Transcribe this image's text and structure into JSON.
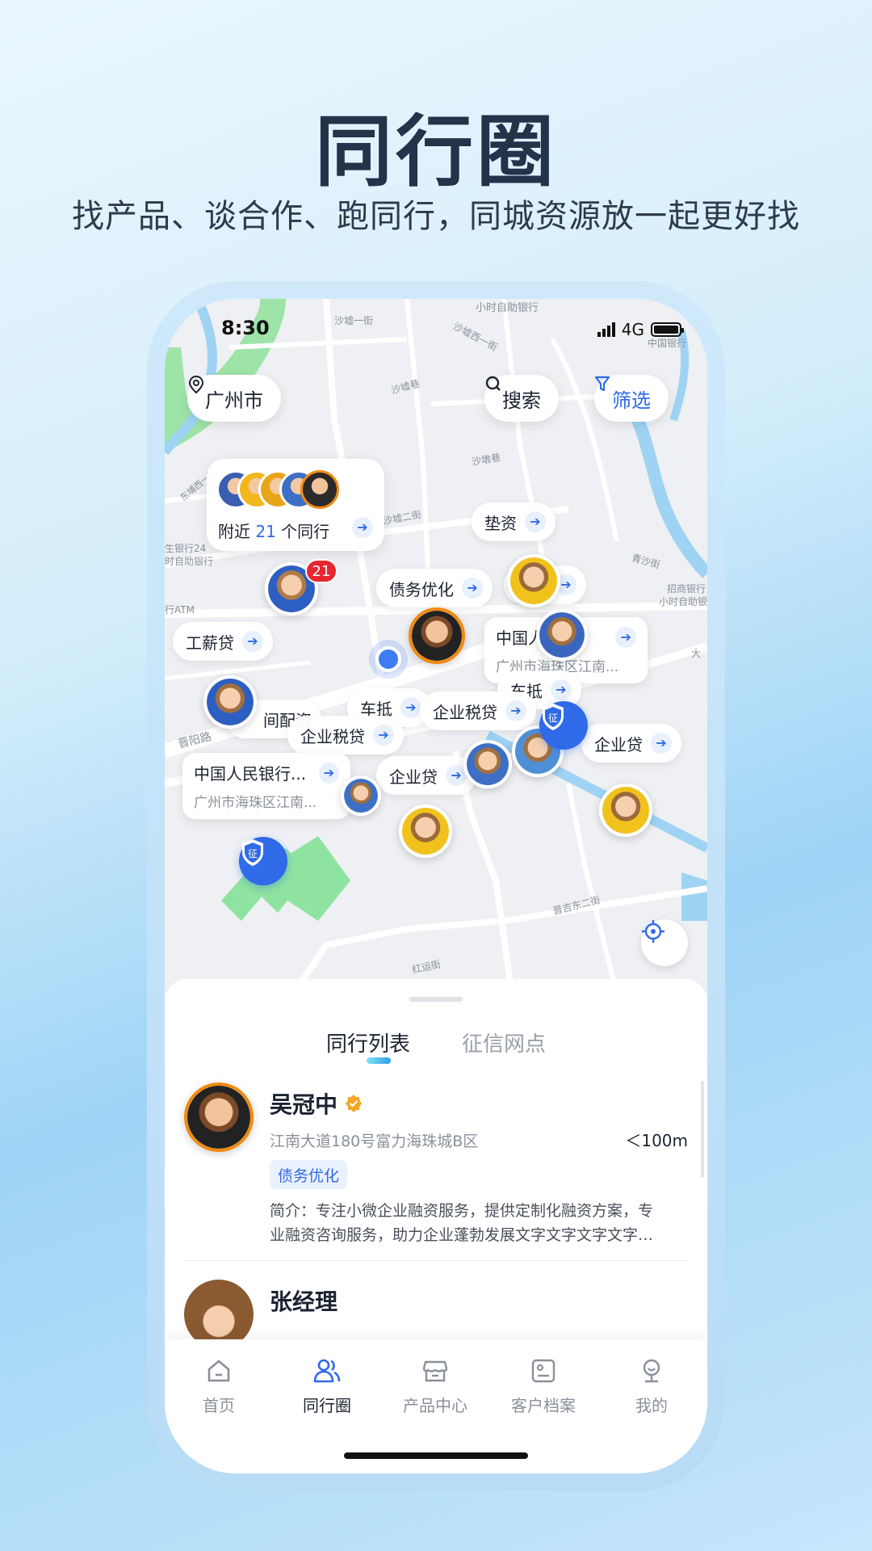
{
  "promo": {
    "title": "同行圈",
    "subtitle": "找产品、谈合作、跑同行，同城资源放一起更好找"
  },
  "status_bar": {
    "time": "8:30",
    "network": "4G"
  },
  "map": {
    "city_button": "广州市",
    "search_button": "搜索",
    "filter_button": "筛选",
    "nearby": {
      "prefix": "附近",
      "count": "21",
      "suffix": "个同行"
    },
    "cluster_badge": "21",
    "tags": {
      "dianzi": "垫资",
      "zhaiwu": "债务优化",
      "gongxin": "工薪贷",
      "chedi1": "车抵",
      "qiye_shuidai1": "企业税贷",
      "qiye_shuidai2": "企业税贷",
      "qiye_dai1": "企业贷",
      "qiye_dai2": "企业贷",
      "chedi2": "车抵",
      "peizi": "间配资",
      "partial": "贷"
    },
    "bank_card_1": {
      "title": "中国人民银行...",
      "address": "广州市海珠区江南..."
    },
    "bank_card_2": {
      "title": "中国人...",
      "address": "广州市海珠区江南..."
    },
    "shield_label": "征",
    "street_labels": {
      "s1": "沙墟一街",
      "s2": "沙墟西一街",
      "s3": "沙墟巷",
      "s4": "沙墟二街",
      "s5": "沙墩巷",
      "s6": "晋阳路",
      "s7": "晋吉东二街",
      "s8": "红运街",
      "s9": "小时自助银行",
      "s10": "中国银行",
      "s11": "招商银行",
      "s12": "小时自助银",
      "s13": "东埔西一路",
      "s14": "生银行24",
      "s15": "时自助银行",
      "s16": "行ATM",
      "s17": "青沙街",
      "s18": "大"
    }
  },
  "sheet": {
    "tabs": [
      "同行列表",
      "征信网点"
    ],
    "items": [
      {
        "name": "吴冠中",
        "address": "江南大道180号富力海珠城B区",
        "distance": "＜100m",
        "tag": "债务优化",
        "intro_line1": "简介：专注小微企业融资服务，提供定制化融资方案，专",
        "intro_line2": "业融资咨询服务，助力企业蓬勃发展文字文字文字文字…"
      },
      {
        "name": "张经理"
      }
    ]
  },
  "tabbar": {
    "items": [
      "首页",
      "同行圈",
      "产品中心",
      "客户档案",
      "我的"
    ],
    "active": "同行圈"
  },
  "colors": {
    "accent": "#2f6ae8",
    "title": "#24324a",
    "badge_red": "#e8272f",
    "orange_ring": "#f08a12"
  }
}
